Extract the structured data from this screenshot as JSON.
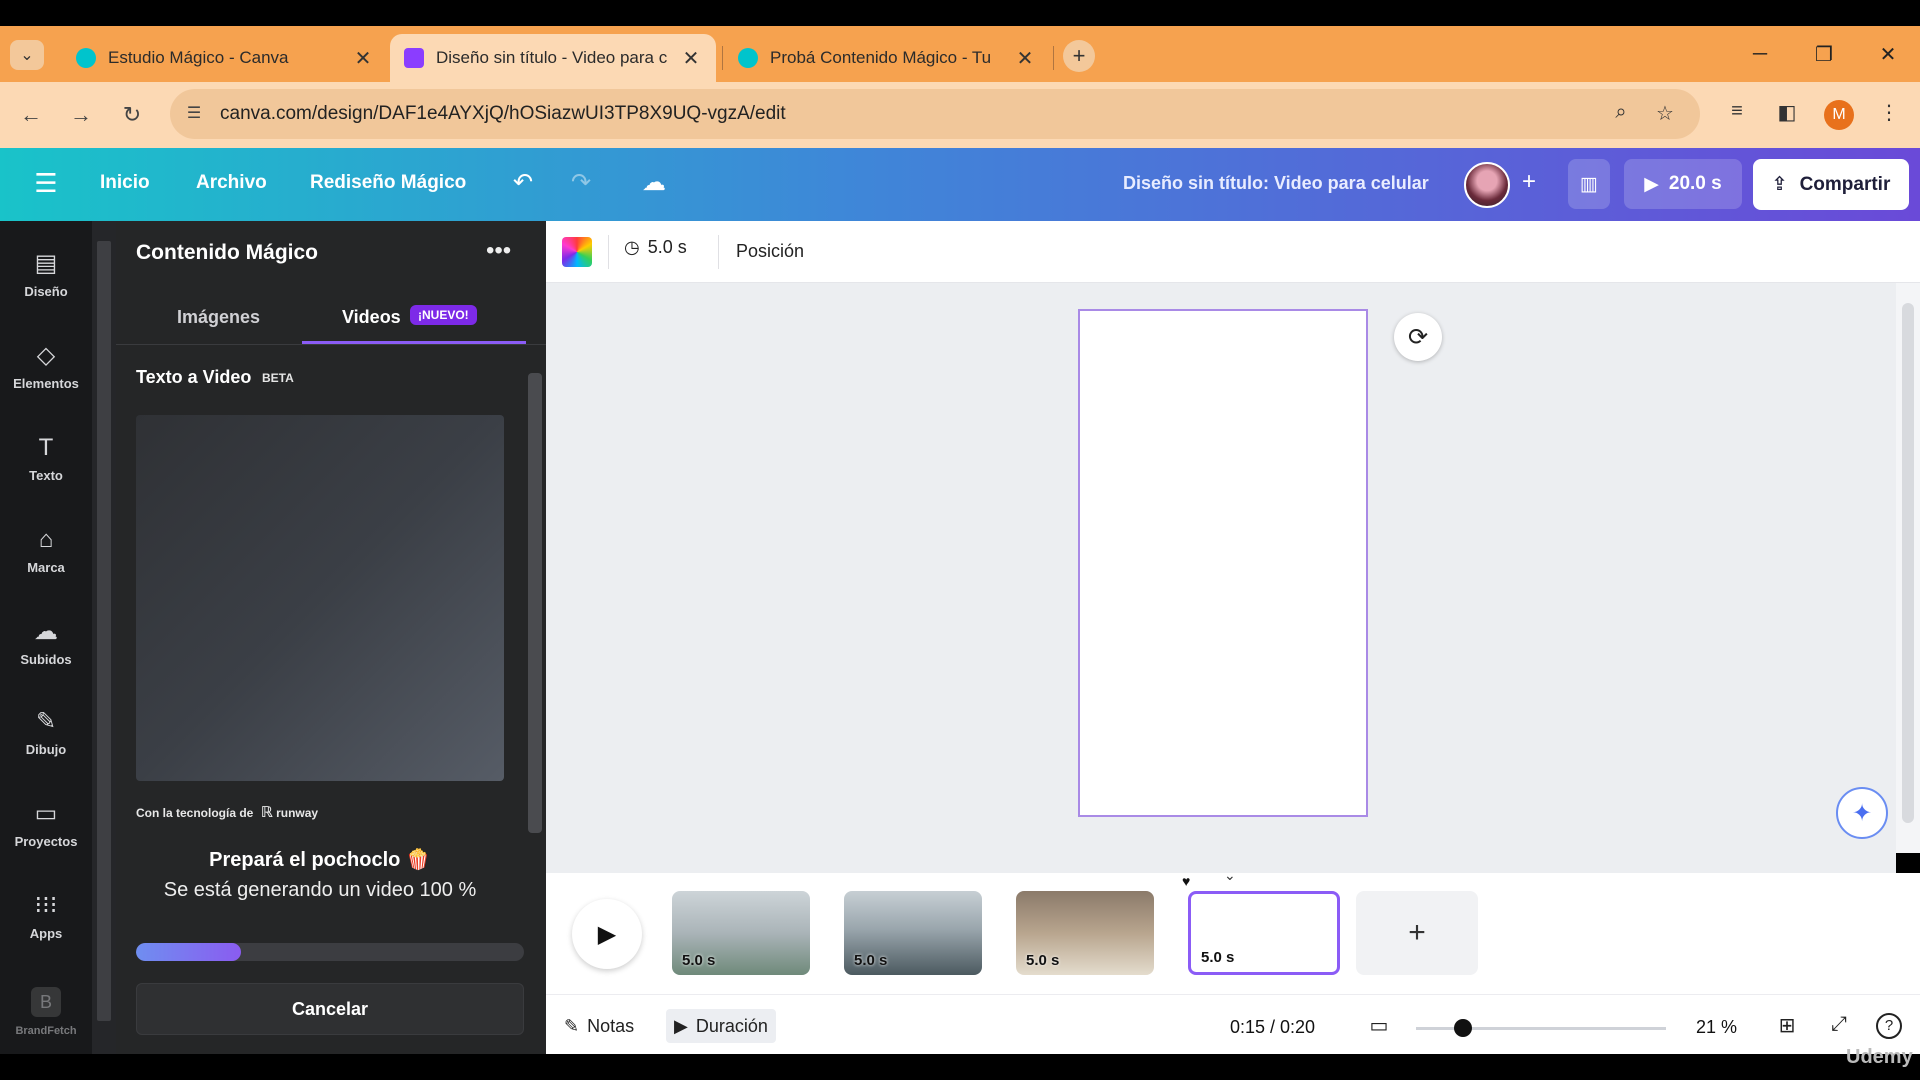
{
  "browser": {
    "tabs": [
      {
        "title": "Estudio Mágico - Canva",
        "favicon_color": "#00c4cc"
      },
      {
        "title": "Diseño sin título - Video para c",
        "favicon_color": "#8b3dff"
      },
      {
        "title": "Probá Contenido Mágico - Tu ",
        "favicon_color": "#00c4cc"
      }
    ],
    "url": "canva.com/design/DAF1e4AYXjQ/hOSiazwUI3TP8X9UQ-vgzA/edit",
    "profile_initial": "M"
  },
  "header": {
    "menu": [
      "Inicio",
      "Archivo",
      "Rediseño Mágico"
    ],
    "doc_title": "Diseño sin título: Video para celular",
    "play_duration": "20.0 s",
    "share_label": "Compartir"
  },
  "rail": [
    {
      "label": "Diseño",
      "icon": "layout-icon"
    },
    {
      "label": "Elementos",
      "icon": "shapes-icon"
    },
    {
      "label": "Texto",
      "icon": "text-icon"
    },
    {
      "label": "Marca",
      "icon": "brand-icon"
    },
    {
      "label": "Subidos",
      "icon": "upload-icon"
    },
    {
      "label": "Dibujo",
      "icon": "draw-icon"
    },
    {
      "label": "Proyectos",
      "icon": "folder-icon"
    },
    {
      "label": "Apps",
      "icon": "apps-icon"
    },
    {
      "label": "BrandFetch",
      "icon": "brandfetch-icon"
    }
  ],
  "panel": {
    "title": "Contenido Mágico",
    "tabs": [
      "Imágenes",
      "Videos"
    ],
    "new_badge": "¡NUEVO!",
    "section_title": "Texto a Video",
    "beta": "BETA",
    "powered_by": "Con la tecnología de",
    "powered_brand": "runway",
    "gen_title": "Prepará el pochoclo 🍿",
    "gen_subtitle": "Se está generando un video 100 %",
    "progress": 0.27,
    "cancel_label": "Cancelar"
  },
  "toolbar": {
    "duration": "5.0 s",
    "position": "Posición"
  },
  "timeline": {
    "clips": [
      {
        "label": "5.0 s",
        "scene": "dogs-surfing"
      },
      {
        "label": "5.0 s",
        "scene": "dogs-beach"
      },
      {
        "label": "5.0 s",
        "scene": "dogs-reading"
      },
      {
        "label": "5.0 s",
        "scene": "empty"
      }
    ]
  },
  "bottom": {
    "notes": "Notas",
    "duration": "Duración",
    "timecode": "0:15 / 0:20",
    "zoom": "21 %"
  },
  "watermark": "Udemy"
}
